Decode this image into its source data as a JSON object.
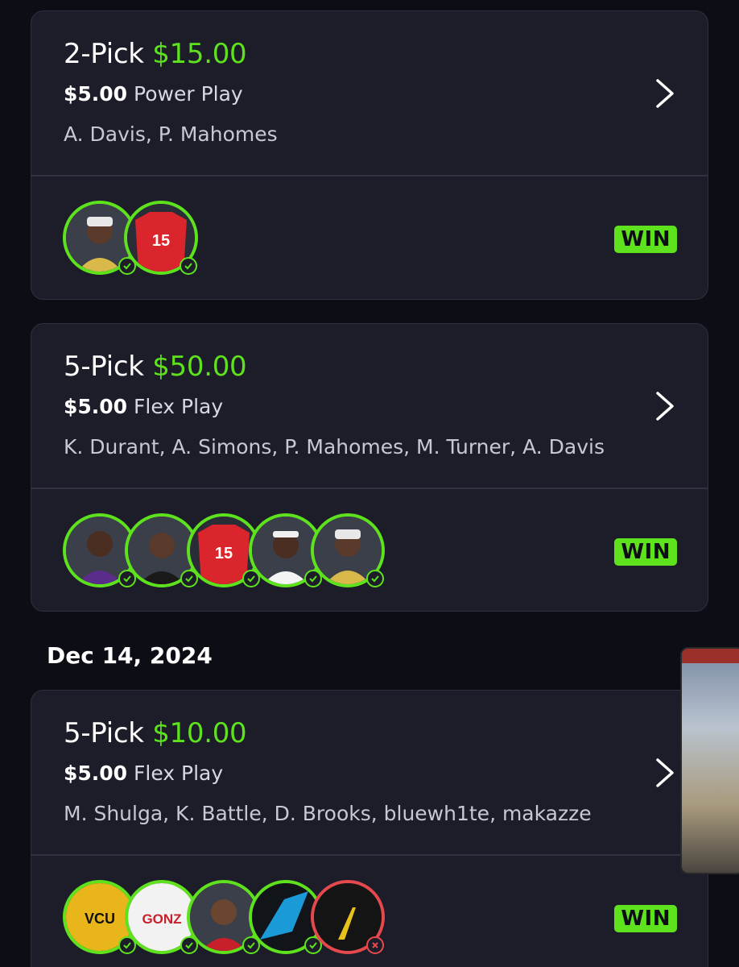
{
  "accent": "#5fe21e",
  "lose_color": "#e5484d",
  "cards": [
    {
      "pick_label": "2-Pick",
      "payout": "$15.00",
      "stake": "$5.00",
      "play_type": "Power Play",
      "players": "A. Davis, P. Mahomes",
      "result": "WIN",
      "avatars": [
        {
          "name": "A. Davis",
          "status": "win"
        },
        {
          "name": "P. Mahomes",
          "status": "win",
          "jersey": "15"
        }
      ]
    },
    {
      "pick_label": "5-Pick",
      "payout": "$50.00",
      "stake": "$5.00",
      "play_type": "Flex Play",
      "players": "K. Durant, A. Simons, P. Mahomes, M. Turner, A. Davis",
      "result": "WIN",
      "avatars": [
        {
          "name": "K. Durant",
          "status": "win"
        },
        {
          "name": "A. Simons",
          "status": "win"
        },
        {
          "name": "P. Mahomes",
          "status": "win",
          "jersey": "15"
        },
        {
          "name": "M. Turner",
          "status": "win"
        },
        {
          "name": "A. Davis",
          "status": "win"
        }
      ]
    },
    {
      "pick_label": "5-Pick",
      "payout": "$10.00",
      "stake": "$5.00",
      "play_type": "Flex Play",
      "players": "M. Shulga, K. Battle, D. Brooks, bluewh1te, makazze",
      "result": "WIN",
      "avatars": [
        {
          "name": "M. Shulga",
          "status": "win",
          "jersey": "VCU"
        },
        {
          "name": "K. Battle",
          "status": "win",
          "jersey": "GONZ"
        },
        {
          "name": "D. Brooks",
          "status": "win"
        },
        {
          "name": "bluewh1te",
          "status": "win"
        },
        {
          "name": "makazze",
          "status": "lose"
        }
      ]
    }
  ],
  "date_header": "Dec 14, 2024"
}
